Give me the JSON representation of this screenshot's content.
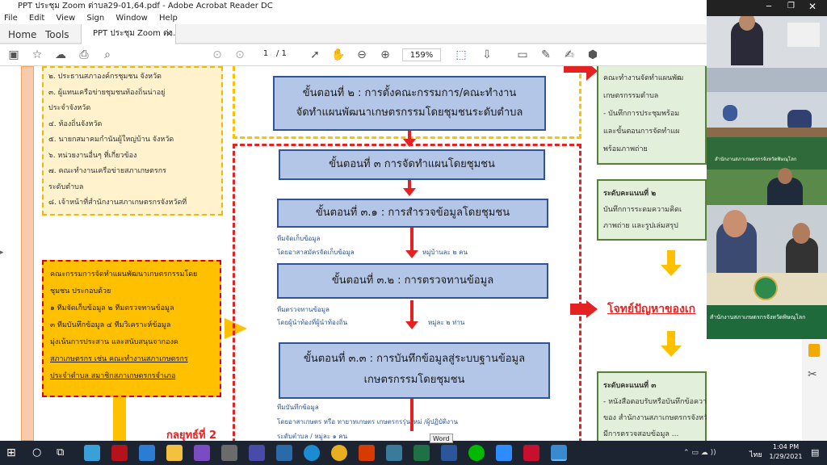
{
  "window": {
    "title": "PPT ประชุม Zoom ต่าบล29-01,64.pdf - Adobe Acrobat Reader DC",
    "menu": [
      "File",
      "Edit",
      "View",
      "Sign",
      "Window",
      "Help"
    ],
    "nav_tabs": [
      "Home",
      "Tools"
    ],
    "doc_tab": "PPT ประชุม Zoom ต่า...",
    "page_current": "1",
    "page_total": "/ 1",
    "zoom": "159%"
  },
  "doc": {
    "left_list": [
      "๒. ประธานสภาองค์กรชุมชน จังหวัด",
      "๓. ผู้แทนเครือข่ายชุมชนท้องถิ่นน่าอยู่",
      "ประจำจังหวัด",
      "๔. ท้องถิ่นจังหวัด",
      "๕. นายกสมาคมกำนันผู้ใหญ่บ้าน จังหวัด",
      "๖. หน่วยงานอื่นๆ ที่เกี่ยวข้อง",
      "๗. คณะทำงานเครือข่ายสภาเกษตรกร",
      "ระดับตำบล",
      "๘. เจ้าหน้าที่สำนักงานสภาเกษตรกรจังหวัดที่"
    ],
    "committee_box": [
      "คณะกรรมการจัดทำแผนพัฒนาเกษตรกรรมโดย",
      "ชุมชน ประกอบด้วย",
      "๑ ทีมจัดเก็บข้อมูล   ๒ ทีมตรวจทานข้อมูล",
      "๓ ทีมบันทึกข้อมูล   ๔ ทีมวิเคราะห์ข้อมูล",
      "มุ่งเน้นการประสาน และสนับสนุนจากองค",
      "สภาเกษตรกร เช่น คณะทำงานสภาเกษตรกร",
      "ประจำตำบล สมาชิกสภาเกษตรกรจำเภอ"
    ],
    "step2_line1": "ขั้นตอนที่ ๒ : การตั้งคณะกรรมการ/คณะทำงาน",
    "step2_line2": "จัดทำแผนพัฒนาเกษตรกรรมโดยชุมชนระดับตำบล",
    "step3": "ขั้นตอนที่ ๓ การจัดทำแผนโดยชุมชน",
    "step31": "ขั้นตอนที่ ๓.๑ : การสำรวจข้อมูลโดยชุมชน",
    "step31_note1": "ทีมจัดเก็บข้อมูล",
    "step31_note2": "โดยอาสาสมัครจัดเก็บข้อมูล",
    "step31_note3": "หมู่บ้านละ   ๒ คน",
    "step32": "ขั้นตอนที่ ๓.๒ : การตรวจทานข้อมูล",
    "step32_note1": "ทีมตรวจทานข้อมูล",
    "step32_note2": "โดยผู้นำท้องที่ผู้นำท้องถิ่น",
    "step32_note3": "หมู่ละ ๒ ท่าน",
    "step33_line1": "ขั้นตอนที่ ๓.๓ : การบันทึกข้อมูลสู่ระบบฐานข้อมูล",
    "step33_line2": "เกษตรกรรมโดยชุมชน",
    "step33_note1": "ทีมบันทึกข้อมูล",
    "step33_note2": "โดยอาสาเกษตร หรือ ทายาทเกษตร  เกษตรกรรุ่นใหม่ /ผู้ปฏิบัติงาน",
    "step33_note3": "ระดับตำบล / หมู่ละ ๑ คน",
    "strategy": "กลยุทธ์ที่ 2",
    "right_top": [
      "คณะทำงานจัดทำแผนพัฒ",
      "เกษตรกรรมตำบล",
      "- บันทึกการประชุมพร้อม",
      "และขั้นตอนการจัดทำแผ",
      "พร้อมภาพถ่าย"
    ],
    "level2_title": "ระดับคะแนนที่ ๒",
    "level2_lines": [
      "บันทึกการระดมความคิดเ",
      "ภาพถ่าย และรูปเล่มสรุป"
    ],
    "problem": "โจทย์ปัญหาของเก",
    "level3_title": "ระดับคะแนนที่ ๓",
    "level3_lines": [
      "- หนังสือตอบรับหรือบันทึกข้อความ",
      "ของ สำนักงานสภาเกษตรกรจังหวัด โดย",
      "มีการตรวจสอบข้อมูล ..."
    ]
  },
  "video": {
    "banner_text": "สำนักงานสภาเกษตรกรจังหวัดพิษณุโลก"
  },
  "taskbar": {
    "tooltip": "Word",
    "time": "1:04 PM",
    "date": "1/29/2021",
    "lang": "ไทย"
  }
}
